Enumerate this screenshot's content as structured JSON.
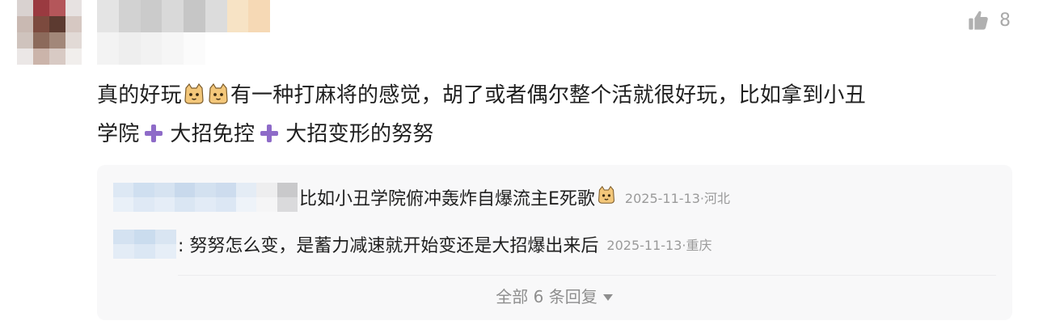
{
  "comment": {
    "like_count": "8",
    "text_line1_a": "真的好玩",
    "text_line1_b": "有一种打麻将的感觉，胡了或者偶尔整个活就很好玩，比如拿到小丑",
    "text_line2_a": "学院",
    "text_line2_b": "大招免控",
    "text_line2_c": "大招变形的努努"
  },
  "replies": [
    {
      "text": "比如小丑学院俯冲轰炸自爆流主E死歌",
      "meta": "2025-11-13·河北"
    },
    {
      "text": ": 努努怎么变，是蓄力减速就开始变还是大招爆出来后",
      "meta": "2025-11-13·重庆"
    }
  ],
  "show_all_label": "全部 6 条回复",
  "icons": {
    "like": "thumbs-up-icon",
    "emoji": "cat-face-emoji",
    "plus": "purple-plus-emoji",
    "expand": "caret-down-icon"
  },
  "colors": {
    "panel_bg": "#f8f8f9",
    "meta_text": "#9a9a9a",
    "plus_purple": "#8e6bc8"
  }
}
